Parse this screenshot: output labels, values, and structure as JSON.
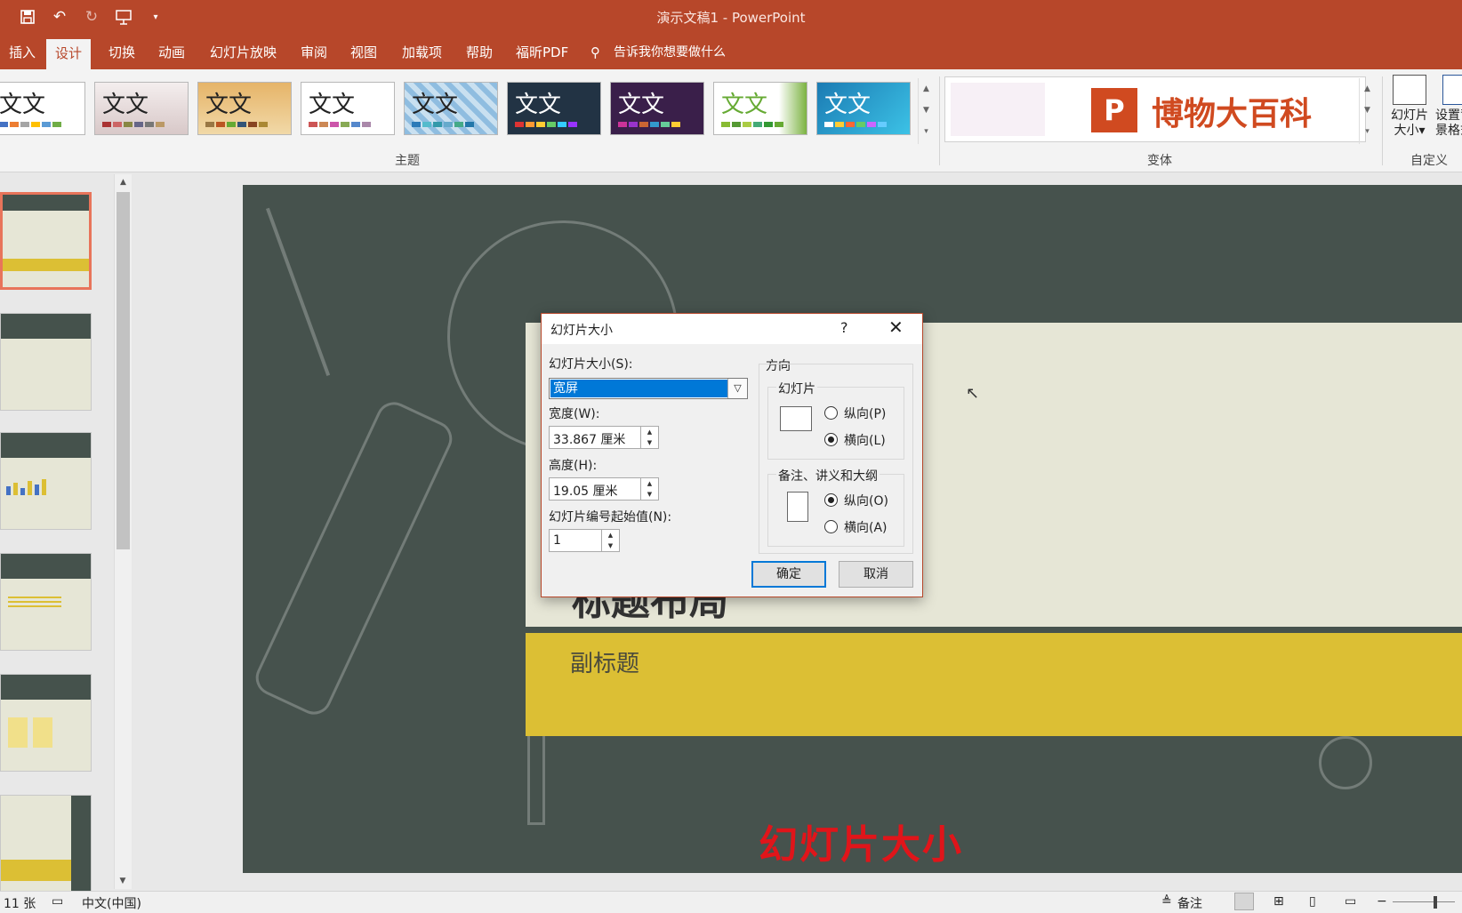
{
  "window": {
    "title": "演示文稿1  -  PowerPoint"
  },
  "qat": {
    "icons": [
      "save-icon",
      "undo-icon",
      "redo-icon",
      "present-icon",
      "customize-icon"
    ]
  },
  "tabs": [
    "插入",
    "设计",
    "切换",
    "动画",
    "幻灯片放映",
    "审阅",
    "视图",
    "加载项",
    "帮助",
    "福昕PDF"
  ],
  "active_tab": "设计",
  "tell_me": "告诉我你想要做什么",
  "ribbon": {
    "themes_label": "主题",
    "variants_label": "变体",
    "customize_label": "自定义",
    "theme_sample_text": "文文",
    "slide_size_btn": "幻灯片\n大小▾",
    "bg_format_btn": "设置背\n景格式",
    "variant_brand": "博物大百科",
    "variant_logo": "P"
  },
  "slide": {
    "subtitle": "副标题",
    "title_partial": "标题布局",
    "overlay_caption": "幻灯片大小"
  },
  "dialog": {
    "title": "幻灯片大小",
    "help": "?",
    "close": "✕",
    "size_label": "幻灯片大小(S):",
    "size_value": "宽屏",
    "width_label": "宽度(W):",
    "width_value": "33.867 厘米",
    "height_label": "高度(H):",
    "height_value": "19.05 厘米",
    "start_label": "幻灯片编号起始值(N):",
    "start_value": "1",
    "orientation_label": "方向",
    "slides_group": "幻灯片",
    "portrait_label": "纵向(P)",
    "landscape_label": "横向(L)",
    "notes_group": "备注、讲义和大纲",
    "notes_portrait_label": "纵向(O)",
    "notes_landscape_label": "横向(A)",
    "slides_orientation": "landscape",
    "notes_orientation": "portrait",
    "ok": "确定",
    "cancel": "取消"
  },
  "status": {
    "slide_count": "11 张",
    "language": "中文(中国)",
    "notes": "备注"
  },
  "colors": {
    "accent": "#b7472a",
    "slide_bg": "#46524d",
    "gold": "#dcbf34"
  }
}
